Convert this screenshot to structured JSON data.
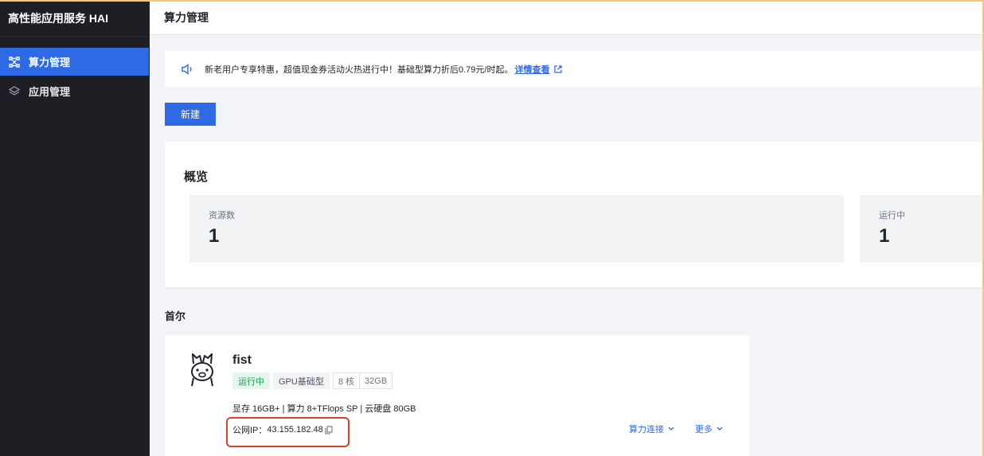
{
  "app": {
    "title": "高性能应用服务 HAI"
  },
  "sidebar": {
    "items": [
      {
        "label": "算力管理",
        "icon": "compute-icon",
        "active": true
      },
      {
        "label": "应用管理",
        "icon": "layers-icon",
        "active": false
      }
    ]
  },
  "header": {
    "title": "算力管理"
  },
  "notice": {
    "icon": "speaker-icon",
    "text": "新老用户专享特惠，超值现金券活动火热进行中！基础型算力折后0.79元/时起。",
    "link_label": "详情查看",
    "link_icon": "external-link-icon"
  },
  "toolbar": {
    "new_label": "新建"
  },
  "overview": {
    "title": "概览",
    "stats": [
      {
        "label": "资源数",
        "value": "1"
      },
      {
        "label": "运行中",
        "value": "1"
      }
    ]
  },
  "region": {
    "name": "首尔"
  },
  "instance": {
    "name": "fist",
    "avatar_icon": "alpaca-icon",
    "status": "运行中",
    "type": "GPU基础型",
    "cores": "8 核",
    "memory": "32GB",
    "spec": "显存 16GB+ | 算力 8+TFlops SP | 云硬盘 80GB",
    "ip_label": "公网IP：",
    "ip_value": "43.155.182.48",
    "copy_icon": "copy-icon",
    "connect_label": "算力连接",
    "more_label": "更多"
  },
  "colors": {
    "accent": "#2f6ae6",
    "sidebar_bg": "#1d1f24",
    "running": "#0e9f5b",
    "highlight": "#d9412b"
  }
}
